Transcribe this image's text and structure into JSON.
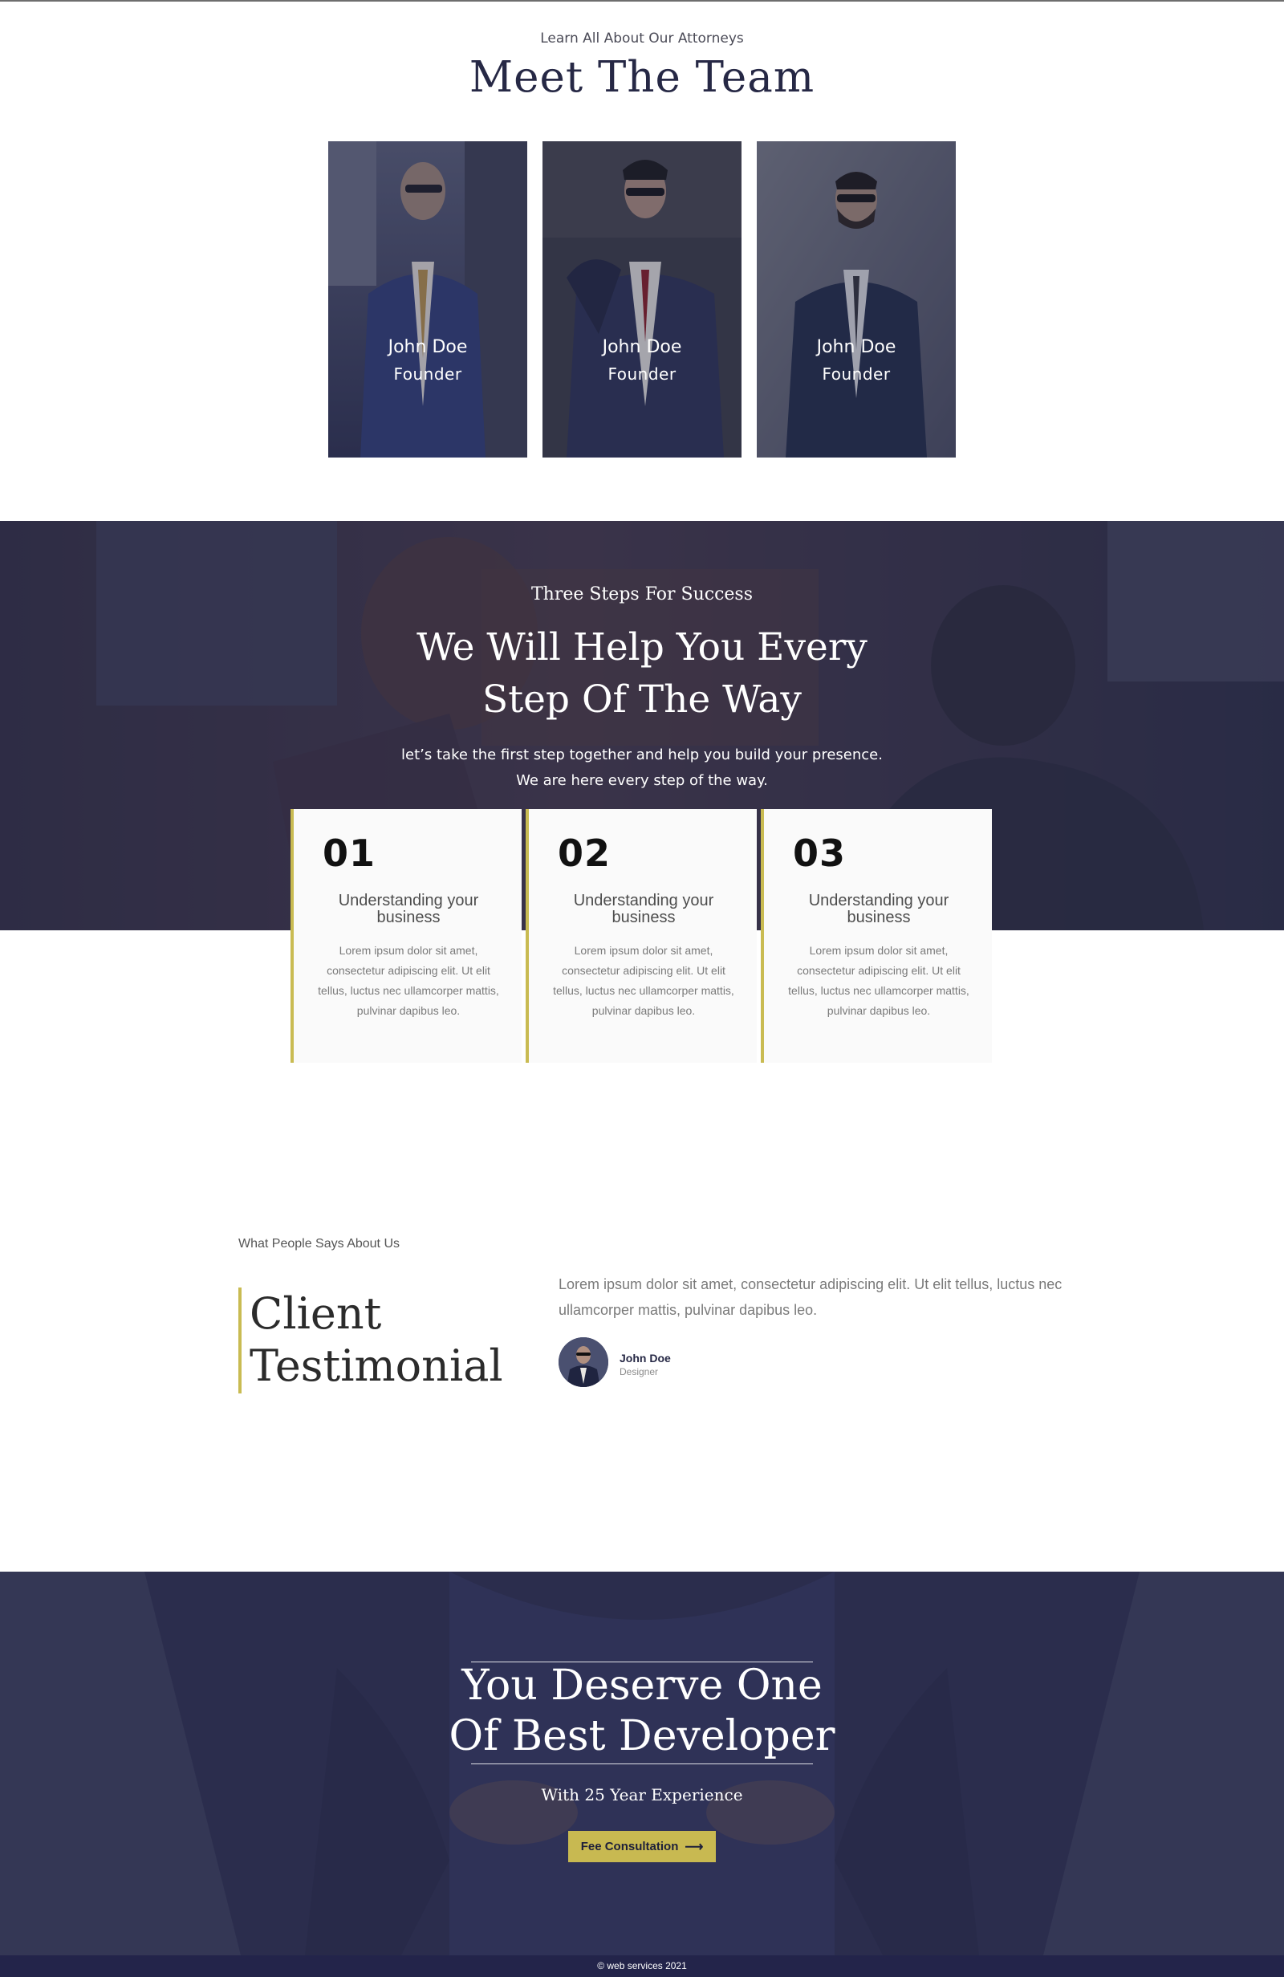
{
  "team": {
    "eyebrow": "Learn All About Our Attorneys",
    "title": "Meet The Team",
    "members": [
      {
        "name": "John Doe",
        "role": "Founder"
      },
      {
        "name": "John Doe",
        "role": "Founder"
      },
      {
        "name": "John Doe",
        "role": "Founder"
      }
    ]
  },
  "steps": {
    "eyebrow": "Three Steps For Success",
    "title_line1": "We Will Help You Every",
    "title_line2": "Step Of The Way",
    "desc_line1": "let’s take the first step together and help you build your presence.",
    "desc_line2": "We are here every step of the way.",
    "cards": [
      {
        "number": "01",
        "heading": "Understanding your business",
        "text": "Lorem ipsum dolor sit amet, consectetur adipiscing elit. Ut elit tellus, luctus nec ullamcorper mattis, pulvinar dapibus leo."
      },
      {
        "number": "02",
        "heading": "Understanding your business",
        "text": "Lorem ipsum dolor sit amet, consectetur adipiscing elit. Ut elit tellus, luctus nec ullamcorper mattis, pulvinar dapibus leo."
      },
      {
        "number": "03",
        "heading": "Understanding your business",
        "text": "Lorem ipsum dolor sit amet, consectetur adipiscing elit. Ut elit tellus, luctus nec ullamcorper mattis, pulvinar dapibus leo."
      }
    ]
  },
  "testimonial": {
    "eyebrow": "What People Says About Us",
    "title_line1": "Client",
    "title_line2": "Testimonial",
    "quote": "Lorem ipsum dolor sit amet, consectetur adipiscing elit. Ut elit tellus, luctus nec ullamcorper mattis, pulvinar dapibus leo.",
    "author_name": "John Doe",
    "author_role": "Designer"
  },
  "cta": {
    "title_line1": "You Deserve One",
    "title_line2": "Of Best Developer",
    "subtitle": "With 25 Year Experience",
    "button_label": "Fee Consultation",
    "button_icon": "arrow-right-icon"
  },
  "footer": {
    "copyright": "© web services 2021"
  },
  "colors": {
    "accent_gold": "#c9bb52",
    "navy": "#262845",
    "footer_bg": "#23244a"
  }
}
